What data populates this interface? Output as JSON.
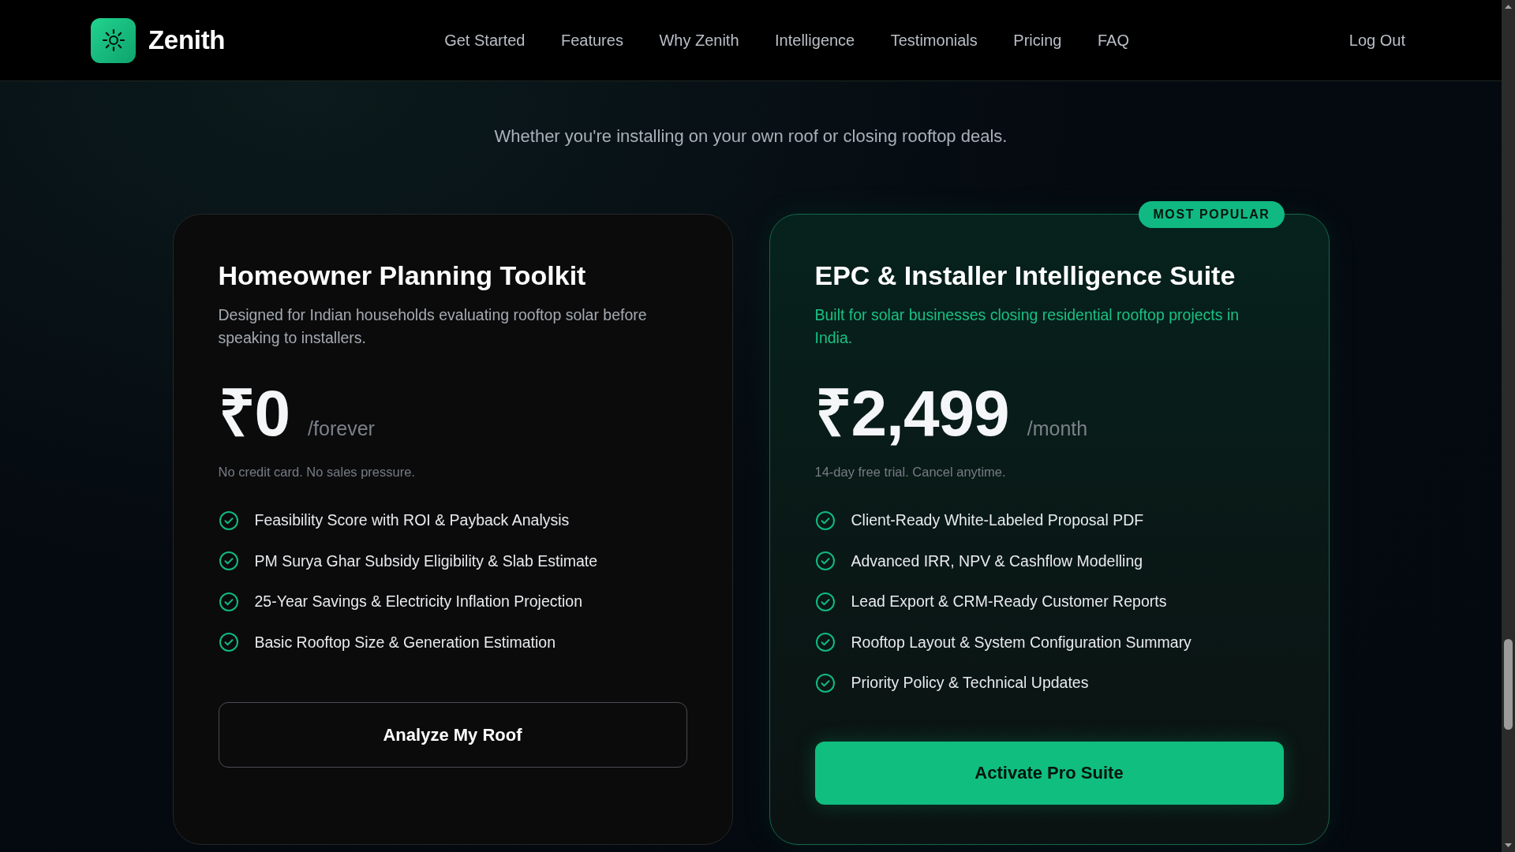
{
  "header": {
    "brand": "Zenith",
    "nav": [
      {
        "label": "Get Started"
      },
      {
        "label": "Features"
      },
      {
        "label": "Why Zenith"
      },
      {
        "label": "Intelligence"
      },
      {
        "label": "Testimonials"
      },
      {
        "label": "Pricing"
      },
      {
        "label": "FAQ"
      }
    ],
    "action": "Log Out"
  },
  "section": {
    "subtitle": "Whether you're installing on your own roof or closing rooftop deals."
  },
  "plans": [
    {
      "featured": false,
      "title": "Homeowner Planning Toolkit",
      "description": "Designed for Indian households evaluating rooftop solar before speaking to installers.",
      "price": "₹0",
      "period": "/forever",
      "note": "No credit card. No sales pressure.",
      "features": [
        "Feasibility Score with ROI & Payback Analysis",
        "PM Surya Ghar Subsidy Eligibility & Slab Estimate",
        "25-Year Savings & Electricity Inflation Projection",
        "Basic Rooftop Size & Generation Estimation"
      ],
      "button": "Analyze My Roof"
    },
    {
      "featured": true,
      "badge": "MOST POPULAR",
      "title": "EPC & Installer Intelligence Suite",
      "description": "Built for solar businesses closing residential rooftop projects in India.",
      "price": "₹2,499",
      "period": "/month",
      "note": "14-day free trial. Cancel anytime.",
      "features": [
        "Client-Ready White-Labeled Proposal PDF",
        "Advanced IRR, NPV & Cashflow Modelling",
        "Lead Export & CRM-Ready Customer Reports",
        "Rooftop Layout & System Configuration Summary",
        "Priority Policy & Technical Updates"
      ],
      "button": "Activate Pro Suite"
    }
  ]
}
